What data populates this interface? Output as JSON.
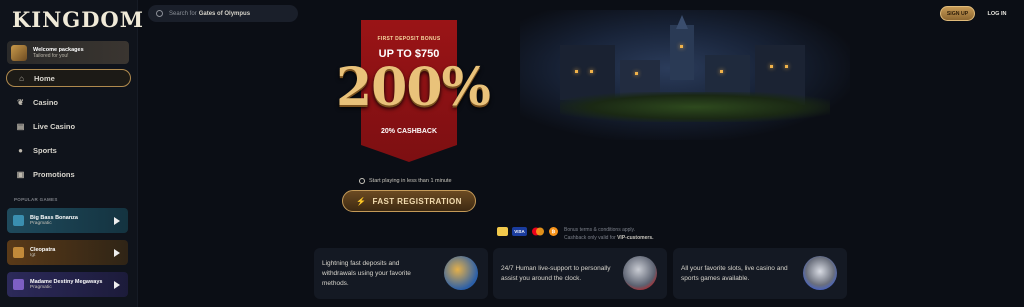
{
  "app": {
    "logo_text": "KINGDOM"
  },
  "header": {
    "search_prefix": "Search for",
    "search_term": "Gates of Olympus",
    "signup_label": "SIGN UP",
    "login_label": "LOG IN"
  },
  "sidebar": {
    "welcome": {
      "title": "Welcome packages",
      "subtitle": "Tailored for you!"
    },
    "nav": [
      {
        "label": "Home",
        "icon": "home-icon"
      },
      {
        "label": "Casino",
        "icon": "cherries-icon"
      },
      {
        "label": "Live Casino",
        "icon": "cards-icon"
      },
      {
        "label": "Sports",
        "icon": "soccer-ball-icon"
      },
      {
        "label": "Promotions",
        "icon": "gift-icon"
      }
    ],
    "popular_title": "POPULAR GAMES",
    "games": [
      {
        "name": "Big Bass Bonanza",
        "provider": "Pragmatic"
      },
      {
        "name": "Cleopatra",
        "provider": "Igt"
      },
      {
        "name": "Madame Destiny Megaways",
        "provider": "Pragmatic"
      }
    ]
  },
  "hero": {
    "banner_label": "FIRST DEPOSIT BONUS",
    "upto": "UP TO $750",
    "percent": "200%",
    "cashback": "20% CASHBACK",
    "play_time": "Start playing in less than 1 minute",
    "cta_label": "FAST REGISTRATION"
  },
  "payments": {
    "methods": [
      "astropay",
      "VISA",
      "mastercard",
      "bitcoin"
    ],
    "terms_line1": "Bonus terms & conditions apply.",
    "terms_line2_prefix": "Cashback only valid for",
    "terms_line2_highlight": "VIP-customers."
  },
  "features": [
    {
      "text": "Lightning fast deposits and withdrawals using your favorite methods.",
      "icon": "money-bag-icon"
    },
    {
      "text": "24/7 Human live-support to personally assist you around the clock.",
      "icon": "knight-helmet-icon"
    },
    {
      "text": "All your favorite slots, live casino and sports games available.",
      "icon": "crown-icon"
    }
  ],
  "colors": {
    "accent_gold": "#c49a58",
    "banner_red": "#9a1416",
    "background": "#0b0e15"
  }
}
